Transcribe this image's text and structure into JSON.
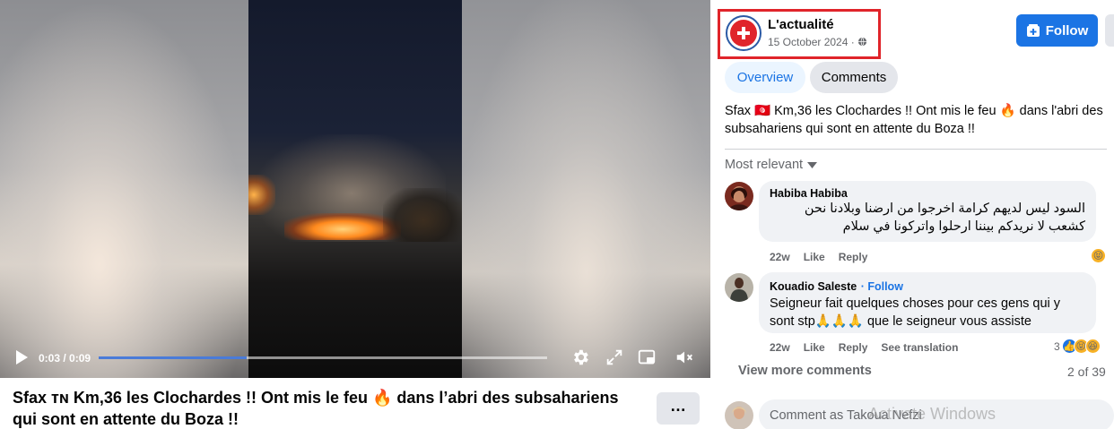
{
  "video": {
    "time": "0:03 / 0:09",
    "progress_fraction": 0.33
  },
  "post": {
    "title": "Sfax ᴛɴ Km,36 les Clochardes !! Ont mis le feu 🔥 dans l’abri des subsahariens qui sont en attente du Boza !!",
    "more_label": "…"
  },
  "page": {
    "name": "L'actualité",
    "date": "15 October 2024 ·",
    "follow_label": "Follow"
  },
  "tabs": [
    {
      "label": "Overview",
      "active": true
    },
    {
      "label": "Comments",
      "active": false
    }
  ],
  "post_text": "Sfax 🇹🇳 Km,36 les Clochardes !! Ont mis le feu 🔥 dans l'abri des subsahariens qui sont en attente du Boza !!",
  "sort_label": "Most relevant",
  "comments": [
    {
      "author": "Habiba Habiba",
      "text_line1": "السود ليس لديهم كرامة اخرجوا من ارضنا وبلادنا نحن",
      "text_line2": "كشعب لا نريدكم بيننا ارحلوا واتركونا في سلام",
      "age": "22w",
      "like": "Like",
      "reply": "Reply"
    },
    {
      "author": "Kouadio Saleste",
      "follow": "· Follow",
      "text_line1": "Seigneur fait quelques choses pour ces gens qui y",
      "text_line2": "sont stp🙏🙏🙏 que le seigneur vous assiste",
      "age": "22w",
      "like": "Like",
      "reply": "Reply",
      "translate": "See translation",
      "reaction_count": "3"
    }
  ],
  "view_more": "View more comments",
  "count": "2 of 39",
  "comment_placeholder": "Comment as Takoua Nefzi",
  "watermark": "Activate Windows",
  "colors": {
    "accent": "#1b74e4",
    "highlight": "#e0242a"
  }
}
